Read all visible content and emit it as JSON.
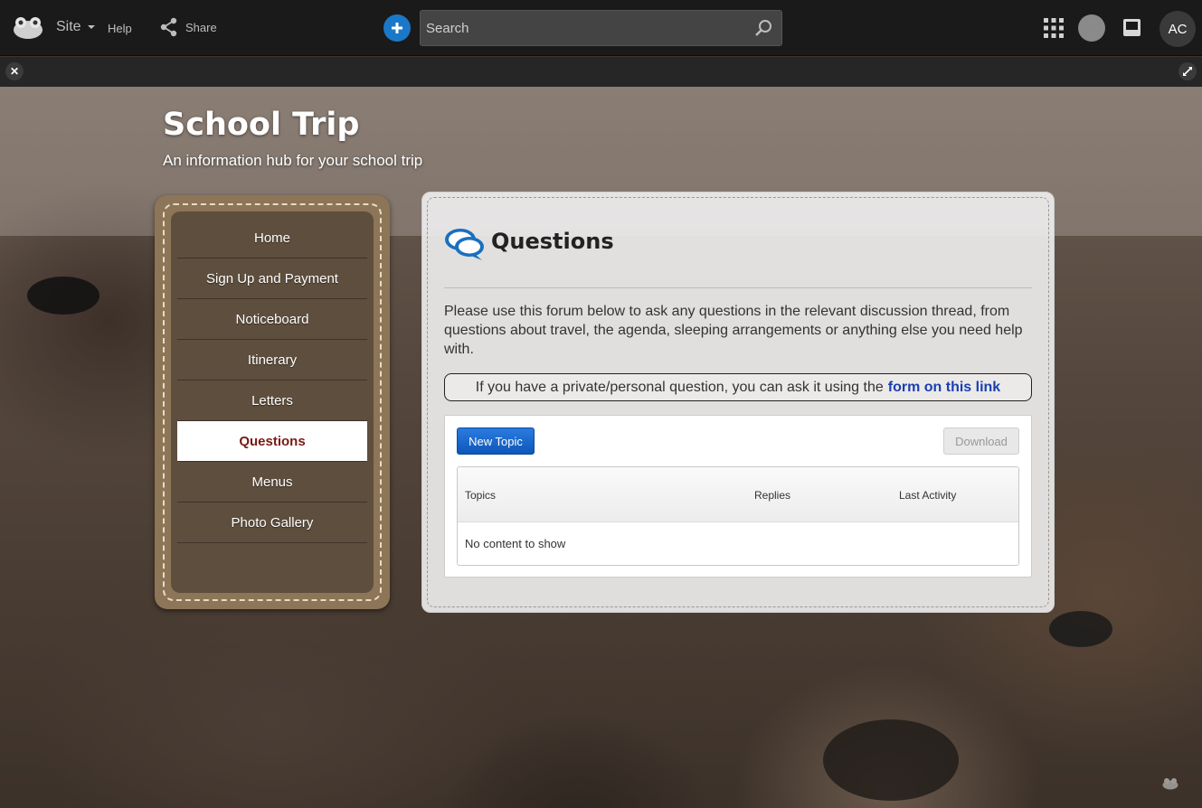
{
  "topbar": {
    "site_label": "Site",
    "help_label": "Help",
    "share_label": "Share",
    "search_placeholder": "Search",
    "avatar_initials": "AC"
  },
  "page": {
    "title": "School Trip",
    "subtitle": "An information hub for your school trip"
  },
  "nav": {
    "items": [
      {
        "label": "Home"
      },
      {
        "label": "Sign Up and Payment"
      },
      {
        "label": "Noticeboard"
      },
      {
        "label": "Itinerary"
      },
      {
        "label": "Letters"
      },
      {
        "label": "Questions"
      },
      {
        "label": "Menus"
      },
      {
        "label": "Photo Gallery"
      }
    ],
    "active_index": 5
  },
  "content": {
    "heading": "Questions",
    "intro": "Please use this forum below to ask any questions in the relevant discussion thread, from questions about travel, the agenda, sleeping arrangements or anything else you need help with.",
    "private_text": "If you have a private/personal question, you can ask it using the",
    "private_link": "form on this link"
  },
  "forum": {
    "new_topic_label": "New Topic",
    "download_label": "Download",
    "columns": [
      "Topics",
      "Replies",
      "Last Activity"
    ],
    "empty_text": "No content to show"
  },
  "colors": {
    "topbar_bg": "#1a1a1a",
    "accent_blue": "#1b78c9",
    "nav_active_text": "#7a1a12",
    "link_blue": "#1a3fb0"
  }
}
